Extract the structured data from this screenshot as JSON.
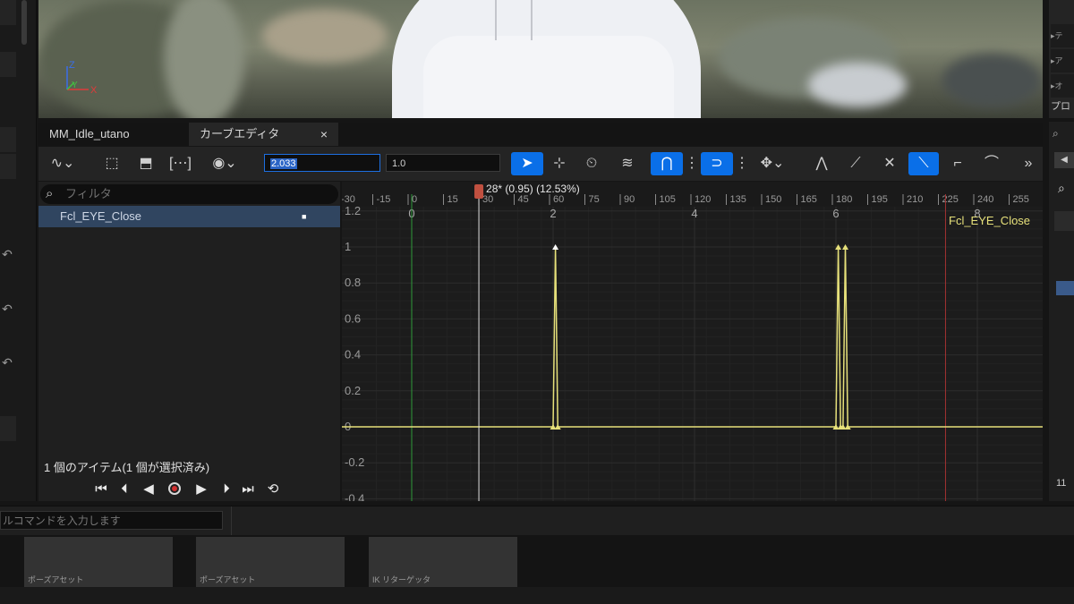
{
  "viewport": {
    "axis_z": "Z",
    "axis_y": "Y",
    "axis_x": "X"
  },
  "right_panel": {
    "items": [
      "テ",
      "ア",
      "オ"
    ],
    "label": "プロ",
    "bottom_num": "11"
  },
  "tabs": [
    {
      "label": "MM_Idle_utano"
    },
    {
      "label": "カーブエディタ",
      "close": "×"
    }
  ],
  "toolbar": {
    "value_input": "2.033",
    "weight_input": "1.0",
    "icons": [
      "curve-icon",
      "select-icon",
      "transform-icon",
      "frame-icon",
      "visibility-icon",
      "pointer-icon",
      "move-keys-icon",
      "retime-icon",
      "wave-icon",
      "snap-time-icon",
      "snap-value-icon",
      "pan-icon",
      "auto-tangent-icon",
      "user-tangent-icon",
      "break-tangent-icon",
      "linear-tangent-icon",
      "step-tangent-icon",
      "flat-tangent-icon",
      "overflow-icon"
    ]
  },
  "tree": {
    "filter_placeholder": "フィルタ",
    "items": [
      {
        "label": "Fcl_EYE_Close",
        "key_indicator": "■"
      }
    ],
    "item_count": "1 個のアイテム(1 個が選択済み)"
  },
  "playback": {
    "buttons": [
      "jump-to-start",
      "step-back",
      "play-reverse",
      "record",
      "play",
      "step-forward",
      "jump-to-end",
      "loop"
    ]
  },
  "graph": {
    "curve_label": "Fcl_EYE_Close",
    "playhead_label": "28* (0.95) (12.53%)",
    "frame_ticks": [
      "-30",
      "-15",
      "0",
      "15",
      "30",
      "45",
      "60",
      "75",
      "90",
      "105",
      "120",
      "135",
      "150",
      "165",
      "180",
      "195",
      "210",
      "225",
      "240",
      "255"
    ],
    "time_ticks": [
      "0",
      "2",
      "4",
      "6",
      "8"
    ],
    "y_ticks": [
      "1.2",
      "1",
      "0.8",
      "0.6",
      "0.4",
      "0.2",
      "0",
      "-0.2",
      "-0.4"
    ],
    "colors": {
      "curve": "#e6e07a",
      "start_marker": "#2e9a3a",
      "end_marker": "#a43232",
      "playhead": "#c05040"
    }
  },
  "chart_data": {
    "type": "line",
    "title": "",
    "xlabel": "",
    "ylabel": "",
    "xlim": [
      -0.05,
      8.5
    ],
    "ylim": [
      -0.4,
      1.2
    ],
    "playhead_time": 0.95,
    "series": [
      {
        "name": "Fcl_EYE_Close",
        "x": [
          0,
          2.0,
          2.033,
          2.066,
          6.0,
          6.033,
          6.066,
          6.1,
          6.133,
          6.167,
          7.5
        ],
        "y": [
          0,
          0,
          1,
          0,
          0,
          1,
          0,
          0,
          1,
          0,
          0
        ]
      }
    ]
  },
  "console": {
    "placeholder": "ルコマンドを入力します"
  },
  "assets": [
    {
      "label": "ポーズアセット"
    },
    {
      "label": "ポーズアセット"
    },
    {
      "label": "IK リターゲッタ"
    }
  ]
}
